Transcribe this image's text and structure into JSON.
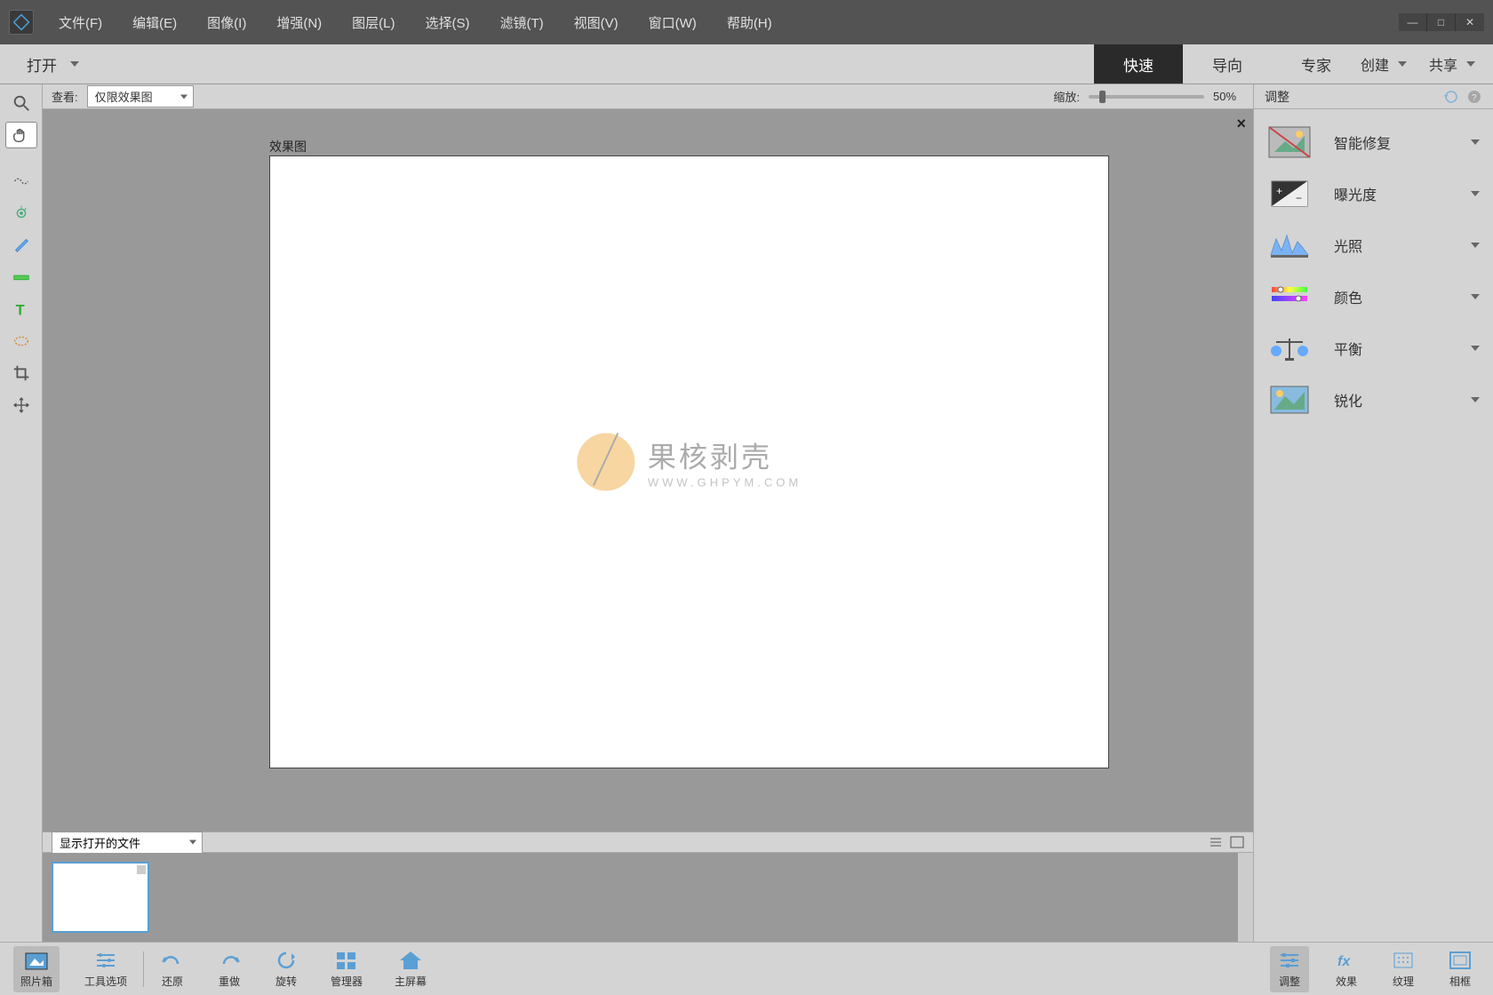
{
  "menubar": {
    "file": "文件(F)",
    "edit": "编辑(E)",
    "image": "图像(I)",
    "enhance": "增强(N)",
    "layer": "图层(L)",
    "select": "选择(S)",
    "filter": "滤镜(T)",
    "view": "视图(V)",
    "window": "窗口(W)",
    "help": "帮助(H)"
  },
  "secondbar": {
    "open": "打开",
    "tab_quick": "快速",
    "tab_guided": "导向",
    "tab_expert": "专家",
    "create": "创建",
    "share": "共享"
  },
  "optionsbar": {
    "view_label": "查看:",
    "view_value": "仅限效果图",
    "zoom_label": "缩放:",
    "zoom_value": "50%"
  },
  "canvas": {
    "label": "效果图",
    "watermark_main": "果核剥壳",
    "watermark_sub": "WWW.GHPYM.COM"
  },
  "photobin": {
    "dropdown": "显示打开的文件"
  },
  "rightpanel": {
    "header": "调整",
    "items": [
      {
        "label": "智能修复"
      },
      {
        "label": "曝光度"
      },
      {
        "label": "光照"
      },
      {
        "label": "颜色"
      },
      {
        "label": "平衡"
      },
      {
        "label": "锐化"
      }
    ]
  },
  "bottombar": {
    "photobin": "照片箱",
    "tooloptions": "工具选项",
    "undo": "还原",
    "redo": "重做",
    "rotate": "旋转",
    "organizer": "管理器",
    "home": "主屏幕",
    "adjust": "调整",
    "effects": "效果",
    "textures": "纹理",
    "frames": "相框"
  }
}
